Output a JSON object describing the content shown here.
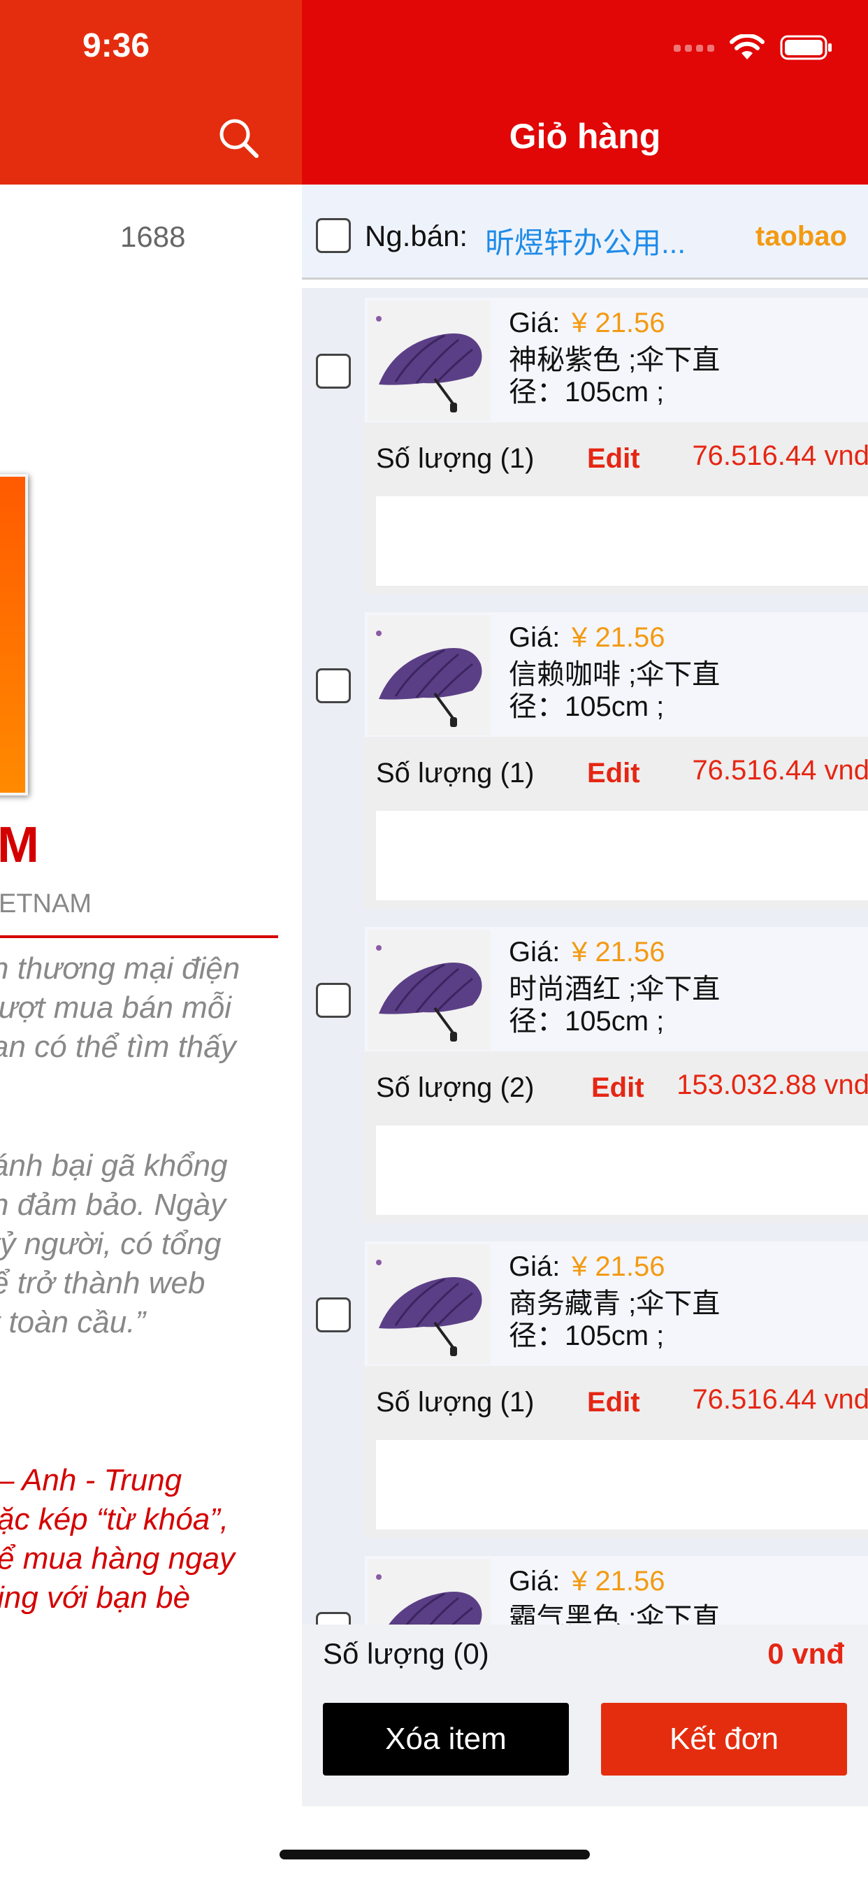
{
  "status_bar": {
    "time": "9:36"
  },
  "left_screen": {
    "tab_label": "1688",
    "heading": "M",
    "subheading": "ETNAM",
    "paragraph1": [
      "n thương mại điện",
      "lượt mua bán mỗi",
      "an có thể tìm thấy",
      "."
    ],
    "paragraph2": [
      "ánh bại gã khổng",
      "n đảm bảo. Ngày",
      "tỷ người, có tổng",
      "ể trở thành web",
      "t toàn cầu.”"
    ],
    "paragraph3": [
      "– Anh - Trung",
      "ặc kép “từ khóa”,",
      "ể mua hàng ngay",
      "ing với bạn bè"
    ]
  },
  "cart": {
    "title": "Giỏ hàng",
    "seller_label": "Ng.bán:",
    "seller_name": "昕煜轩办公用...",
    "source": "taobao",
    "items": [
      {
        "price_label": "Giá:",
        "price": "¥ 21.56",
        "desc": "神秘紫色 ;伞下直径：105cm ;",
        "qty": "Số lượng (1)",
        "edit": "Edit",
        "total": "76.516.44 vnd"
      },
      {
        "price_label": "Giá:",
        "price": "¥ 21.56",
        "desc": "信赖咖啡 ;伞下直径：105cm ;",
        "qty": "Số lượng (1)",
        "edit": "Edit",
        "total": "76.516.44 vnd"
      },
      {
        "price_label": "Giá:",
        "price": "¥ 21.56",
        "desc": "时尚酒红 ;伞下直径：105cm ;",
        "qty": "Số lượng (2)",
        "edit": "Edit",
        "total": "153.032.88 vnd"
      },
      {
        "price_label": "Giá:",
        "price": "¥ 21.56",
        "desc": "商务藏青 ;伞下直径：105cm ;",
        "qty": "Số lượng (1)",
        "edit": "Edit",
        "total": "76.516.44 vnd"
      },
      {
        "price_label": "Giá:",
        "price": "¥ 21.56",
        "desc": "霸气黑色 ;伞下直",
        "qty": "",
        "edit": "",
        "total": ""
      }
    ],
    "footer": {
      "qty": "Số lượng (0)",
      "total": "0 vnđ",
      "delete_label": "Xóa item",
      "order_label": "Kết đơn"
    }
  },
  "colors": {
    "header_red": "#e10707",
    "price_orange": "#f39a12",
    "link_blue": "#1e8be8",
    "total_red": "#e52613"
  }
}
